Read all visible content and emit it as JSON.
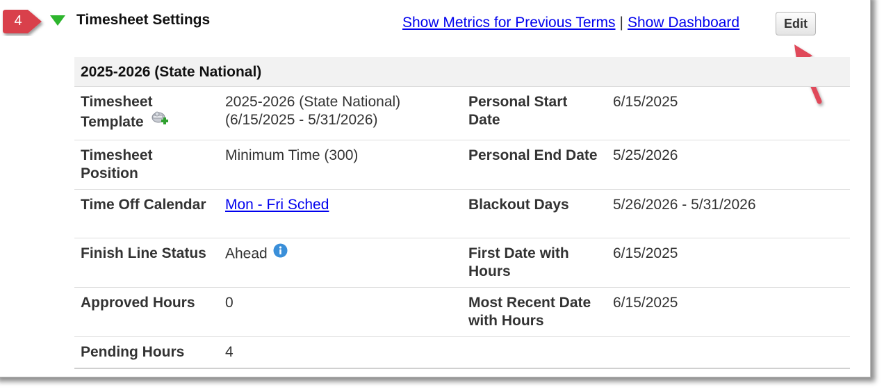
{
  "step_badge": "4",
  "section": {
    "title": "Timesheet Settings"
  },
  "links": {
    "previous_terms": "Show Metrics for Previous Terms",
    "separator": "|",
    "dashboard": "Show Dashboard"
  },
  "edit_button": "Edit",
  "panel": {
    "header": "2025-2026 (State National)",
    "rows": [
      {
        "label1": "Timesheet Template",
        "value1": "2025-2026 (State National) (6/15/2025 - 5/31/2026)",
        "label2": "Personal Start Date",
        "value2": "6/15/2025"
      },
      {
        "label1": "Timesheet Position",
        "value1": "Minimum Time (300)",
        "label2": "Personal End Date",
        "value2": "5/25/2026"
      },
      {
        "label1": "Time Off Calendar",
        "value1": "Mon - Fri Sched",
        "label2": "Blackout Days",
        "value2": "5/26/2026 - 5/31/2026"
      },
      {
        "label1": "Finish Line Status",
        "value1": "Ahead",
        "label2": "First Date with Hours",
        "value2": "6/15/2025"
      },
      {
        "label1": "Approved Hours",
        "value1": "0",
        "label2": "Most Recent Date with Hours",
        "value2": "6/15/2025"
      },
      {
        "label1": "Pending Hours",
        "value1": "4"
      }
    ]
  },
  "colors": {
    "badge": "#d93f4c",
    "toggle": "#2db52d",
    "link": "#0000ee",
    "arrow": "#e0485a",
    "info": "#3a8fd9"
  },
  "icons": {
    "toggle": "triangle-down-icon",
    "template": "template-add-icon",
    "info": "info-icon",
    "callout": "pointer-arrow-icon"
  }
}
